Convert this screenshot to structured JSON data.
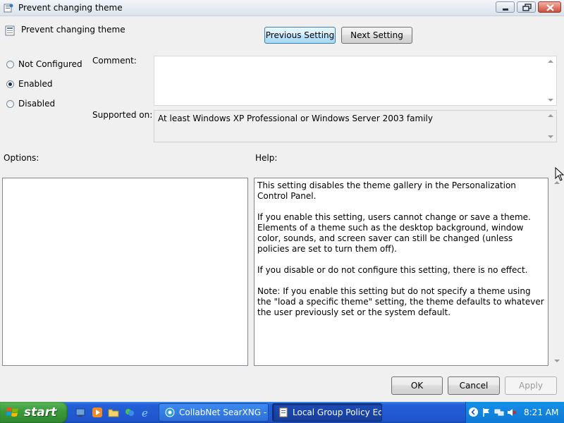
{
  "window": {
    "title": "Prevent changing theme",
    "setting_name": "Prevent changing theme"
  },
  "nav": {
    "previous_label": "Previous Setting",
    "next_label": "Next Setting"
  },
  "state": {
    "options": [
      {
        "label": "Not Configured",
        "checked": false
      },
      {
        "label": "Enabled",
        "checked": true
      },
      {
        "label": "Disabled",
        "checked": false
      }
    ]
  },
  "comment": {
    "label": "Comment:",
    "value": ""
  },
  "supported": {
    "label": "Supported on:",
    "value": "At least Windows XP Professional or Windows Server 2003 family"
  },
  "options_label": "Options:",
  "help": {
    "label": "Help:",
    "paragraphs": [
      "This setting disables the theme gallery in the Personalization Control Panel.",
      "If you enable this setting, users cannot change or save a theme.  Elements of a theme such as the desktop background, window color, sounds, and screen saver can still be changed (unless policies are set to turn them off).",
      "If you disable or do not configure this setting, there is no effect.",
      "Note: If you enable this setting but do not specify a theme using the \"load a specific theme\" setting, the theme defaults to whatever the user previously set or the system default."
    ]
  },
  "buttons": {
    "ok": "OK",
    "cancel": "Cancel",
    "apply": "Apply"
  },
  "taskbar": {
    "start_label": "start",
    "tasks": [
      {
        "label": "CollabNet SearXNG - S...",
        "active": false
      },
      {
        "label": "Local Group Policy Editor",
        "active": true
      }
    ],
    "clock": "8:21 AM"
  }
}
